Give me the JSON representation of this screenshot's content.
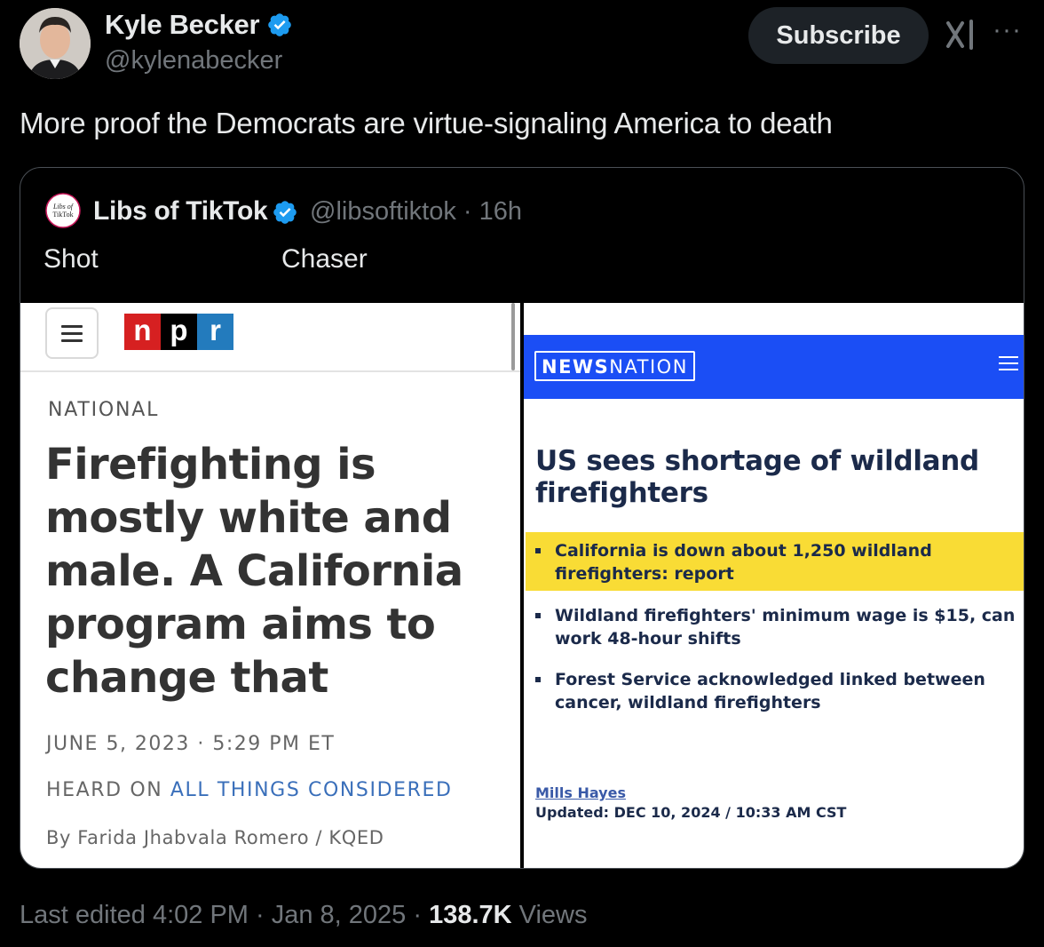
{
  "author": {
    "display_name": "Kyle Becker",
    "handle": "@kylenabecker"
  },
  "header": {
    "subscribe_label": "Subscribe"
  },
  "tweet": {
    "text": "More proof the Democrats are virtue-signaling America to death"
  },
  "quoted": {
    "avatar_text": "Libs of TikTok",
    "display_name": "Libs of TikTok",
    "handle_time": "@libsoftiktok · 16h",
    "label_left": "Shot",
    "label_right": "Chaser",
    "npr": {
      "logo_n": "n",
      "logo_p": "p",
      "logo_r": "r",
      "section": "NATIONAL",
      "headline": "Firefighting is mostly white and male. A California program aims to change that",
      "date": "JUNE 5, 2023 · 5:29 PM ET",
      "heard_prefix": "HEARD ON ",
      "heard_link": "ALL THINGS CONSIDERED",
      "byline": "By Farida Jhabvala Romero / KQED"
    },
    "newsnation": {
      "logo_bold": "NEWS",
      "logo_light": "NATION",
      "headline": "US sees shortage of wildland firefighters",
      "bullets": [
        "California is down about 1,250 wildland firefighters: report",
        "Wildland firefighters' minimum wage is $15, can work 48-hour shifts",
        "Forest Service acknowledged linked between cancer, wildland firefighters"
      ],
      "author": "Mills Hayes",
      "updated": "Updated: DEC 10, 2024 / 10:33 AM CST"
    }
  },
  "footer": {
    "prefix": "Last edited 4:02 PM · Jan 8, 2025 · ",
    "views_count": "138.7K",
    "views_label": " Views"
  },
  "colors": {
    "verified_blue": "#1d9bf0",
    "npr_red": "#d62021",
    "npr_blue": "#237bbd",
    "newsnation_blue": "#1b4ef5",
    "highlight_yellow": "#f9dc35"
  }
}
